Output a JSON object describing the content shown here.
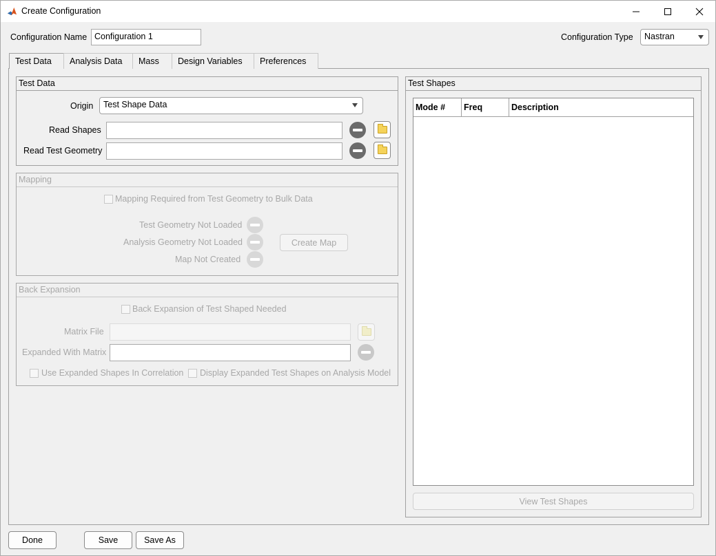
{
  "window": {
    "title": "Create Configuration",
    "app_icon": "matlab-icon",
    "minimize_icon": "minimize-icon",
    "maximize_icon": "maximize-icon",
    "close_icon": "close-icon"
  },
  "header": {
    "config_name_label": "Configuration Name",
    "config_name_value": "Configuration 1",
    "config_type_label": "Configuration Type",
    "config_type_value": "Nastran"
  },
  "tabs": [
    {
      "label": "Test Data",
      "active": true
    },
    {
      "label": "Analysis Data",
      "active": false
    },
    {
      "label": "Mass",
      "active": false
    },
    {
      "label": "Design Variables",
      "active": false
    },
    {
      "label": "Preferences",
      "active": false
    }
  ],
  "test_data_panel": {
    "title": "Test Data",
    "origin_label": "Origin",
    "origin_value": "Test Shape Data",
    "read_shapes_label": "Read Shapes",
    "read_shapes_value": "",
    "read_geometry_label": "Read Test Geometry",
    "read_geometry_value": ""
  },
  "mapping_panel": {
    "title": "Mapping",
    "checkbox_label": "Mapping Required from Test Geometry to Bulk Data",
    "status_test_geometry": "Test Geometry Not Loaded",
    "status_analysis_geometry": "Analysis Geometry Not Loaded",
    "status_map": "Map Not Created",
    "create_map_label": "Create Map"
  },
  "back_expansion_panel": {
    "title": "Back Expansion",
    "checkbox_label": "Back Expansion of Test Shaped Needed",
    "matrix_file_label": "Matrix File",
    "matrix_file_value": "",
    "expanded_with_label": "Expanded With Matrix",
    "expanded_with_value": "",
    "use_expanded_label": "Use Expanded Shapes In Correlation",
    "display_expanded_label": "Display Expanded Test Shapes on Analysis Model"
  },
  "test_shapes_panel": {
    "title": "Test Shapes",
    "columns": [
      "Mode #",
      "Freq",
      "Description"
    ],
    "rows": [],
    "view_button_label": "View Test Shapes"
  },
  "footer": {
    "done_label": "Done",
    "save_label": "Save",
    "save_as_label": "Save As"
  }
}
